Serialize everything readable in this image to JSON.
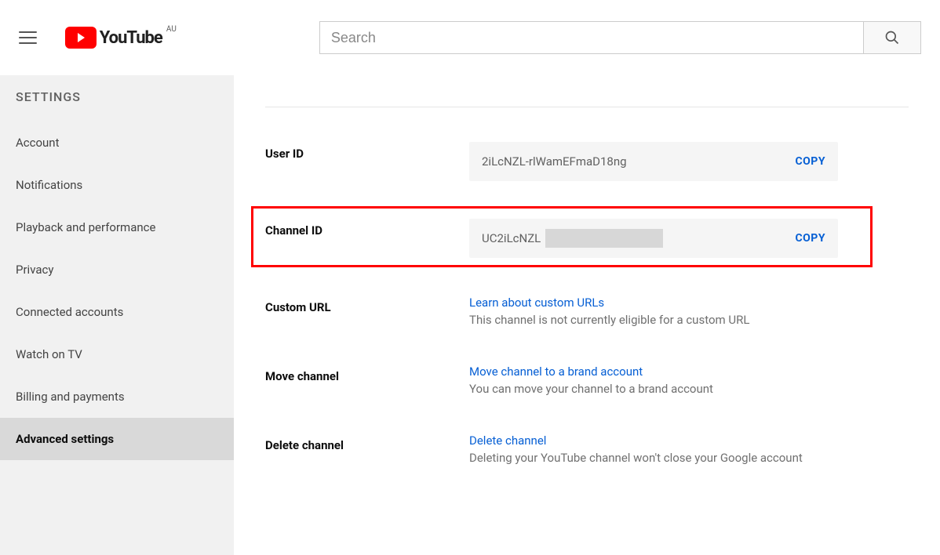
{
  "header": {
    "logo_text": "YouTube",
    "logo_region": "AU",
    "search_placeholder": "Search"
  },
  "sidebar": {
    "title": "SETTINGS",
    "items": [
      {
        "label": "Account"
      },
      {
        "label": "Notifications"
      },
      {
        "label": "Playback and performance"
      },
      {
        "label": "Privacy"
      },
      {
        "label": "Connected accounts"
      },
      {
        "label": "Watch on TV"
      },
      {
        "label": "Billing and payments"
      },
      {
        "label": "Advanced settings"
      }
    ]
  },
  "main": {
    "user_id": {
      "label": "User ID",
      "value": "2iLcNZL-rlWamEFmaD18ng",
      "copy": "COPY"
    },
    "channel_id": {
      "label": "Channel ID",
      "value": "UC2iLcNZL",
      "copy": "COPY"
    },
    "custom_url": {
      "label": "Custom URL",
      "link": "Learn about custom URLs",
      "desc": "This channel is not currently eligible for a custom URL"
    },
    "move_channel": {
      "label": "Move channel",
      "link": "Move channel to a brand account",
      "desc": "You can move your channel to a brand account"
    },
    "delete_channel": {
      "label": "Delete channel",
      "link": "Delete channel",
      "desc": "Deleting your YouTube channel won't close your Google account"
    }
  }
}
